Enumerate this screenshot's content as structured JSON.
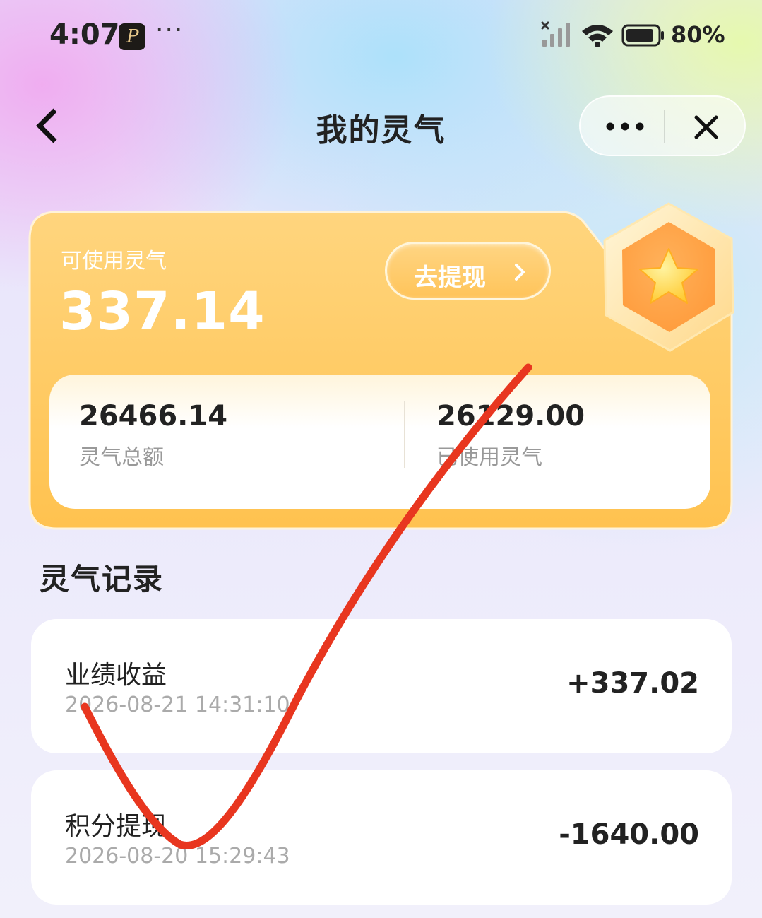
{
  "status_bar": {
    "time": "4:07",
    "notification_letter": "P",
    "more": "···",
    "battery_percent": "80%"
  },
  "nav": {
    "title": "我的灵气"
  },
  "balance": {
    "available_label": "可使用灵气",
    "available_value": "337.14",
    "withdraw_label": "去提现",
    "total_value": "26466.14",
    "total_label": "灵气总额",
    "used_value": "26129.00",
    "used_label": "已使用灵气"
  },
  "records": {
    "title": "灵气记录",
    "items": [
      {
        "title": "业绩收益",
        "time": "2026-08-21 14:31:10",
        "amount": "+337.02"
      },
      {
        "title": "积分提现",
        "time": "2026-08-20 15:29:43",
        "amount": "-1640.00"
      }
    ]
  },
  "colors": {
    "card_orange": "#ffc95e",
    "annotation_red": "#e8361f"
  },
  "icons": [
    "back-icon",
    "more-icon",
    "close-icon",
    "chevron-right-icon",
    "star-badge-icon",
    "signal-icon",
    "wifi-icon",
    "battery-icon"
  ]
}
